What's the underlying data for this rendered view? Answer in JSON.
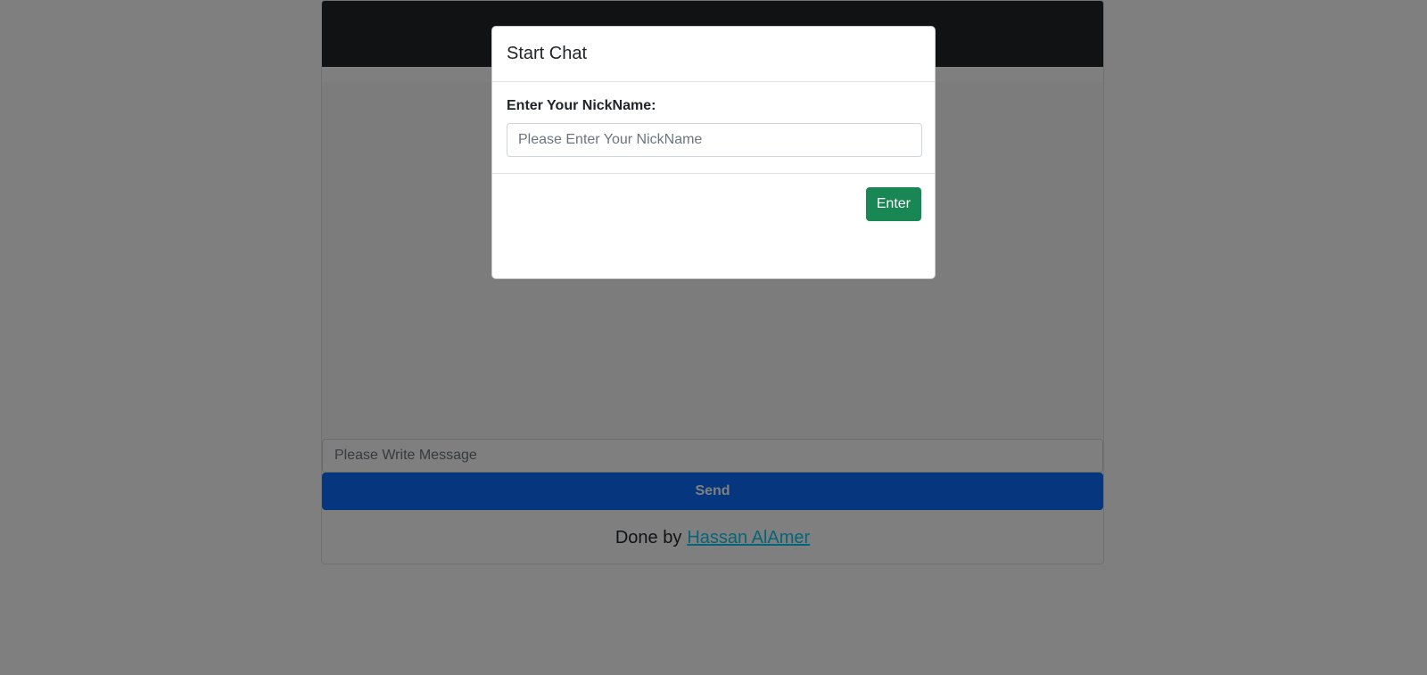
{
  "chat": {
    "header_title": "",
    "message_placeholder": "Please Write Message",
    "send_label": "Send",
    "footer_prefix": "Done by",
    "footer_author": "Hassan AlAmer"
  },
  "modal": {
    "title": "Start Chat",
    "nickname_label": "Enter Your NickName:",
    "nickname_placeholder": "Please Enter Your NickName",
    "enter_label": "Enter"
  },
  "colors": {
    "header_bg": "#212529",
    "send_button": "#0d6efd",
    "enter_button": "#198754",
    "link": "#0dcaf0",
    "backdrop": "rgba(0,0,0,0.5)"
  }
}
